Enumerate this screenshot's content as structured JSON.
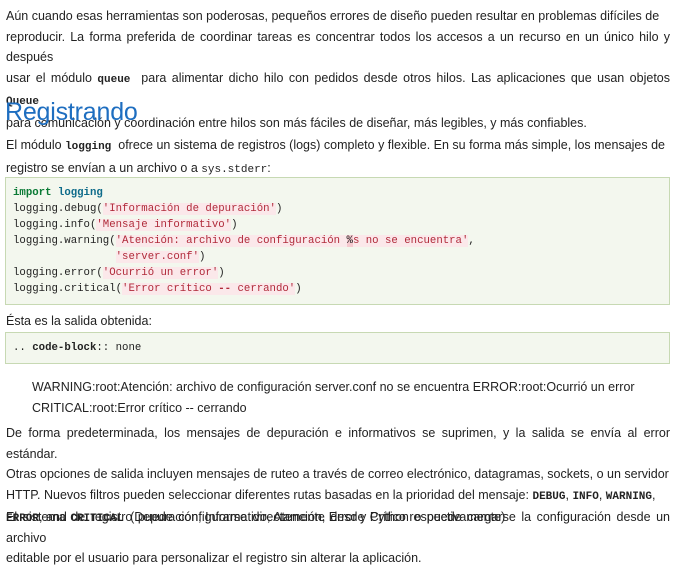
{
  "para1": {
    "line1": "Aún cuando esas herramientas son poderosas, pequeños errores de diseño pueden resultar en problemas difíciles de",
    "line2": "reproducir. La forma preferida de coordinar tareas es concentrar todos los accesos a un recurso en un único hilo y después",
    "line3_a": "usar el módulo",
    "line3_code": "queue",
    "line3_b": "para alimentar dicho hilo con pedidos desde otros hilos. Las aplicaciones que usan objetos",
    "line3_code2": "Queue",
    "line4": "para comunicación y coordinación entre hilos son más fáciles de diseñar, más legibles, y más confiables."
  },
  "heading": "Registrando",
  "para2": {
    "line1_a": "El módulo",
    "line1_code": "logging",
    "line1_b": "ofrece un sistema de registros (logs) completo y flexible. En su forma más simple, los mensajes de",
    "line2_a": "registro se envían a un archivo o a",
    "line2_code": "sys.stderr",
    "line2_b": ":"
  },
  "code1": {
    "l1_kw": "import",
    "l1_mod": "logging",
    "l2_fn": "logging.debug(",
    "l2_str": "'Información de depuración'",
    "l2_end": ")",
    "l3_fn": "logging.info(",
    "l3_str": "'Mensaje informativo'",
    "l3_end": ")",
    "l4_fn": "logging.warning(",
    "l4_str_a": "'Atención: archivo de configuración ",
    "l4_err": "%",
    "l4_str_b": "s no se encuentra'",
    "l4_end": ",",
    "l5_pad": "                ",
    "l5_str": "'server.conf'",
    "l5_end": ")",
    "l6_fn": "logging.error(",
    "l6_str": "'Ocurrió un error'",
    "l6_end": ")",
    "l7_fn": "logging.critical(",
    "l7_str_a": "'Error crítico ",
    "l7_op": "--",
    "l7_str_b": " cerrando'",
    "l7_end": ")"
  },
  "para3": "Ésta es la salida obtenida:",
  "code2": {
    "prefix": ".. ",
    "directive": "code-block",
    "suffix": ":: none"
  },
  "output": {
    "line1": "WARNING:root:Atención: archivo de configuración server.conf no se encuentra ERROR:root:Ocurrió un error",
    "line2": "CRITICAL:root:Error crítico -- cerrando"
  },
  "para4": {
    "line1": "De forma predeterminada, los mensajes de depuración e informativos se suprimen, y la salida se envía al error estándar.",
    "line2": "Otras opciones de salida incluyen mensajes de ruteo a través de correo electrónico, datagramas, sockets, o un servidor",
    "line3_a": "HTTP. Nuevos filtros pueden seleccionar diferentes rutas basadas en la prioridad del mensaje:",
    "line3_c1": "DEBUG",
    "line3_c2": "INFO",
    "line3_c3": "WARNING",
    "line4_c1": "ERROR",
    "line4_and": ", and",
    "line4_c2": "CRITICAL",
    "line4_b": "(Depuración, Informativo, Atención, Error y Crítico respectivamente)"
  },
  "para5": {
    "line1": "El sistema de registro puede configurarse directamente desde Python o puede cargarse la configuración desde un archivo",
    "line2": "editable por el usuario para personalizar el registro sin alterar la aplicación."
  }
}
